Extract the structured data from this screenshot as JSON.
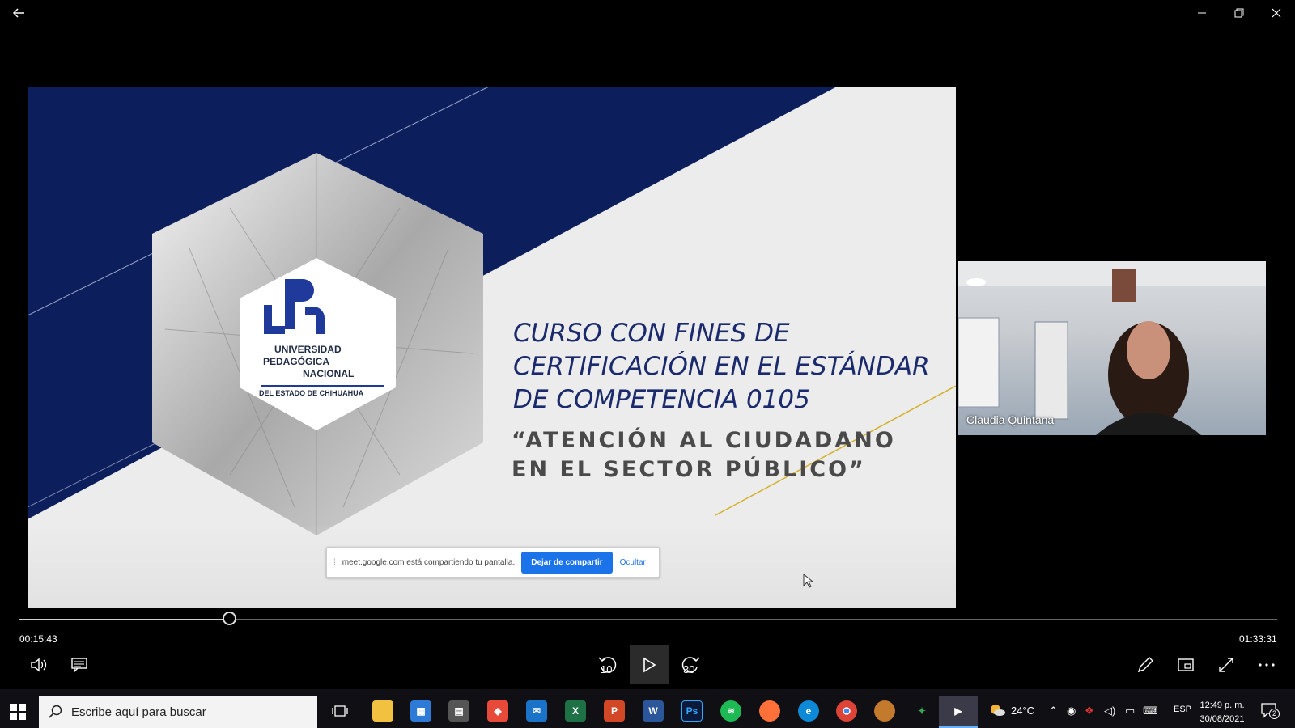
{
  "window": {
    "back_icon": "arrow-left-icon",
    "minimize_icon": "minimize-icon",
    "restore_icon": "restore-icon",
    "close_icon": "close-icon"
  },
  "slide": {
    "logo_lines": [
      "UNIVERSIDAD",
      "PEDAGÓGICA",
      "NACIONAL",
      "DEL ESTADO DE CHIHUAHUA"
    ],
    "logo_mark": "upn",
    "title_lines": [
      "CURSO CON FINES DE",
      "CERTIFICACIÓN EN EL ESTÁNDAR",
      "DE COMPETENCIA 0105"
    ],
    "subtitle_lines": [
      "“ATENCIÓN AL CIUDADANO",
      "EN EL SECTOR PÚBLICO”"
    ],
    "colors": {
      "navy": "#0c1f5c",
      "accent_line": "#d4b02a",
      "title": "#1a2a6c"
    }
  },
  "share_bar": {
    "message": "meet.google.com está compartiendo tu pantalla.",
    "stop_label": "Dejar de compartir",
    "hide_label": "Ocultar"
  },
  "participant": {
    "name": "Claudia Quintana"
  },
  "player": {
    "current_time": "00:15:43",
    "duration": "01:33:31",
    "progress": 0.168,
    "skip_back_label": "10",
    "skip_forward_label": "30"
  },
  "taskbar": {
    "search_placeholder": "Escribe aquí para buscar",
    "apps": [
      "task-view",
      "file-explorer",
      "calendar",
      "calculator",
      "anydesk",
      "mail",
      "excel",
      "powerpoint",
      "word",
      "photoshop",
      "spotify",
      "firefox",
      "edge",
      "chrome",
      "app-stack",
      "app-green",
      "movies-tv"
    ],
    "weather_temp": "24°C",
    "language": "ESP",
    "time": "12:49 p. m.",
    "date": "30/08/2021",
    "notification_count": "2"
  }
}
